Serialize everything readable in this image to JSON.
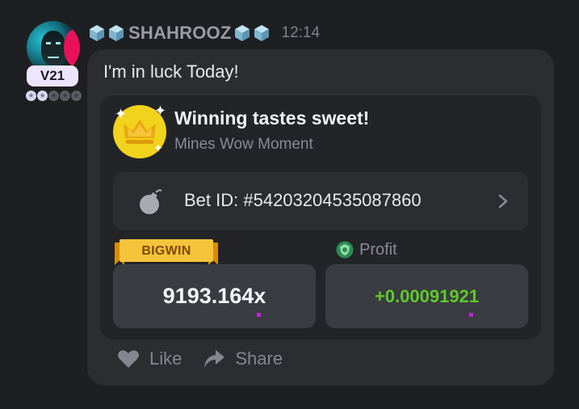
{
  "user": {
    "name": "SHAHROOZ",
    "timestamp": "12:14",
    "level_badge": "V21",
    "level_stars_filled": 2,
    "level_stars_total": 5
  },
  "message": {
    "text": "I'm in luck Today!"
  },
  "win_card": {
    "title": "Winning tastes sweet!",
    "subtitle": "Mines Wow Moment",
    "bet_id": "Bet ID: #54203204535087860",
    "bigwin_label": "BIGWIN",
    "profit_label": "Profit",
    "multiplier": "9193.164x",
    "profit_value": "+0.00091921"
  },
  "actions": {
    "like_label": "Like",
    "share_label": "Share"
  },
  "colors": {
    "background": "#1e1f22",
    "bubble": "#2b2d31",
    "card": "#232428",
    "value_box": "#3a3c42",
    "profit_green": "#5fc928",
    "crown_gold": "#f1d21c",
    "badge_bg": "#ece5ff"
  },
  "icons": [
    "ice-cube-icon",
    "crown-icon",
    "bomb-icon",
    "chevron-right-icon",
    "shield-icon",
    "heart-icon",
    "share-arrow-icon",
    "star-icon"
  ]
}
